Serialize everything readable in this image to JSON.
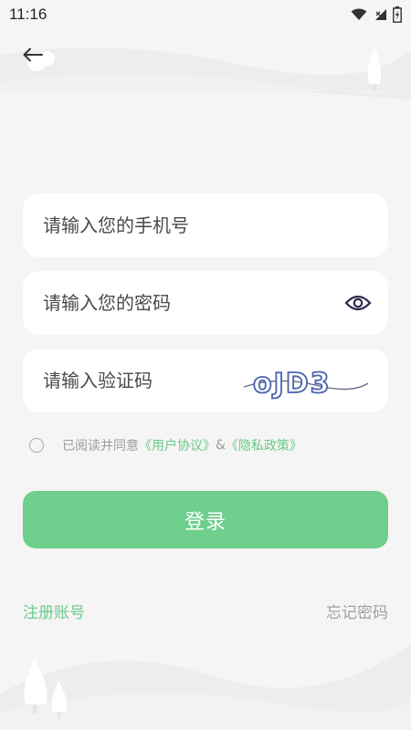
{
  "status_bar": {
    "time": "11:16",
    "icons": [
      "wifi-icon",
      "signal-icon",
      "battery-icon"
    ]
  },
  "header": {
    "back_icon": "arrow-left-icon"
  },
  "form": {
    "phone_placeholder": "请输入您的手机号",
    "password_placeholder": "请输入您的密码",
    "password_toggle_icon": "eye-icon",
    "code_placeholder": "请输入验证码",
    "captcha_text": "oJD3"
  },
  "agreement": {
    "prefix": "已阅读并同意",
    "user_agreement": "《用户协议》",
    "connector": "&",
    "privacy_policy": "《隐私政策》"
  },
  "login_button": "登录",
  "footer": {
    "register": "注册账号",
    "forgot_password": "忘记密码"
  },
  "colors": {
    "background": "#f4f5f4",
    "accent": "#6fcf8c",
    "link": "#6cc98a",
    "muted": "#a0a0a0"
  }
}
